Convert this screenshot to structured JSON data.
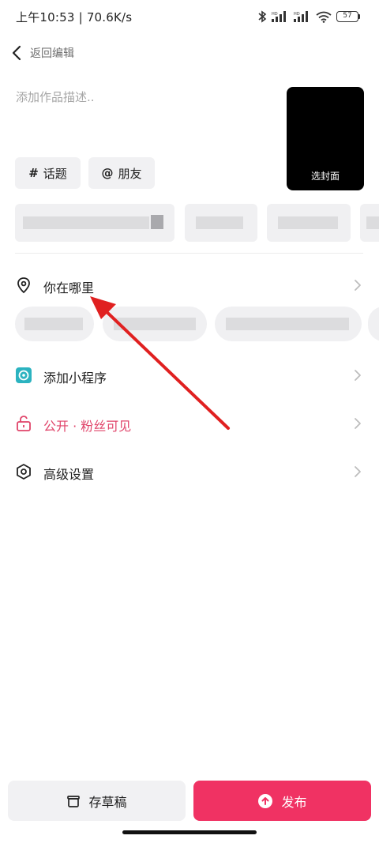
{
  "status_bar": {
    "time_speed": "上午10:53 | 70.6K/s",
    "battery": "57",
    "icons": [
      "bluetooth-icon",
      "signal-icon",
      "signal-icon",
      "wifi-icon",
      "battery-icon"
    ]
  },
  "nav": {
    "back_label": "返回编辑",
    "back_icon": "chevron-left-icon"
  },
  "compose": {
    "description_placeholder": "添加作品描述..",
    "description_value": "",
    "cover_label": "选封面",
    "topic_symbol": "#",
    "topic_label": "话题",
    "friend_symbol": "@",
    "friend_label": "朋友"
  },
  "options": {
    "location": {
      "label": "你在哪里",
      "icon": "location-pin-icon"
    },
    "mini_program": {
      "label": "添加小程序",
      "icon": "mini-program-icon"
    },
    "privacy": {
      "label": "公开 · 粉丝可见",
      "icon": "unlock-icon",
      "color": "#e0446a"
    },
    "advanced": {
      "label": "高级设置",
      "icon": "hexagon-settings-icon"
    }
  },
  "actions": {
    "draft_label": "存草稿",
    "draft_icon": "draft-box-icon",
    "publish_label": "发布",
    "publish_icon": "upload-circle-icon",
    "publish_color": "#f03263"
  },
  "annotation": {
    "arrow_color": "#e02020",
    "points_to": "你在哪里"
  }
}
